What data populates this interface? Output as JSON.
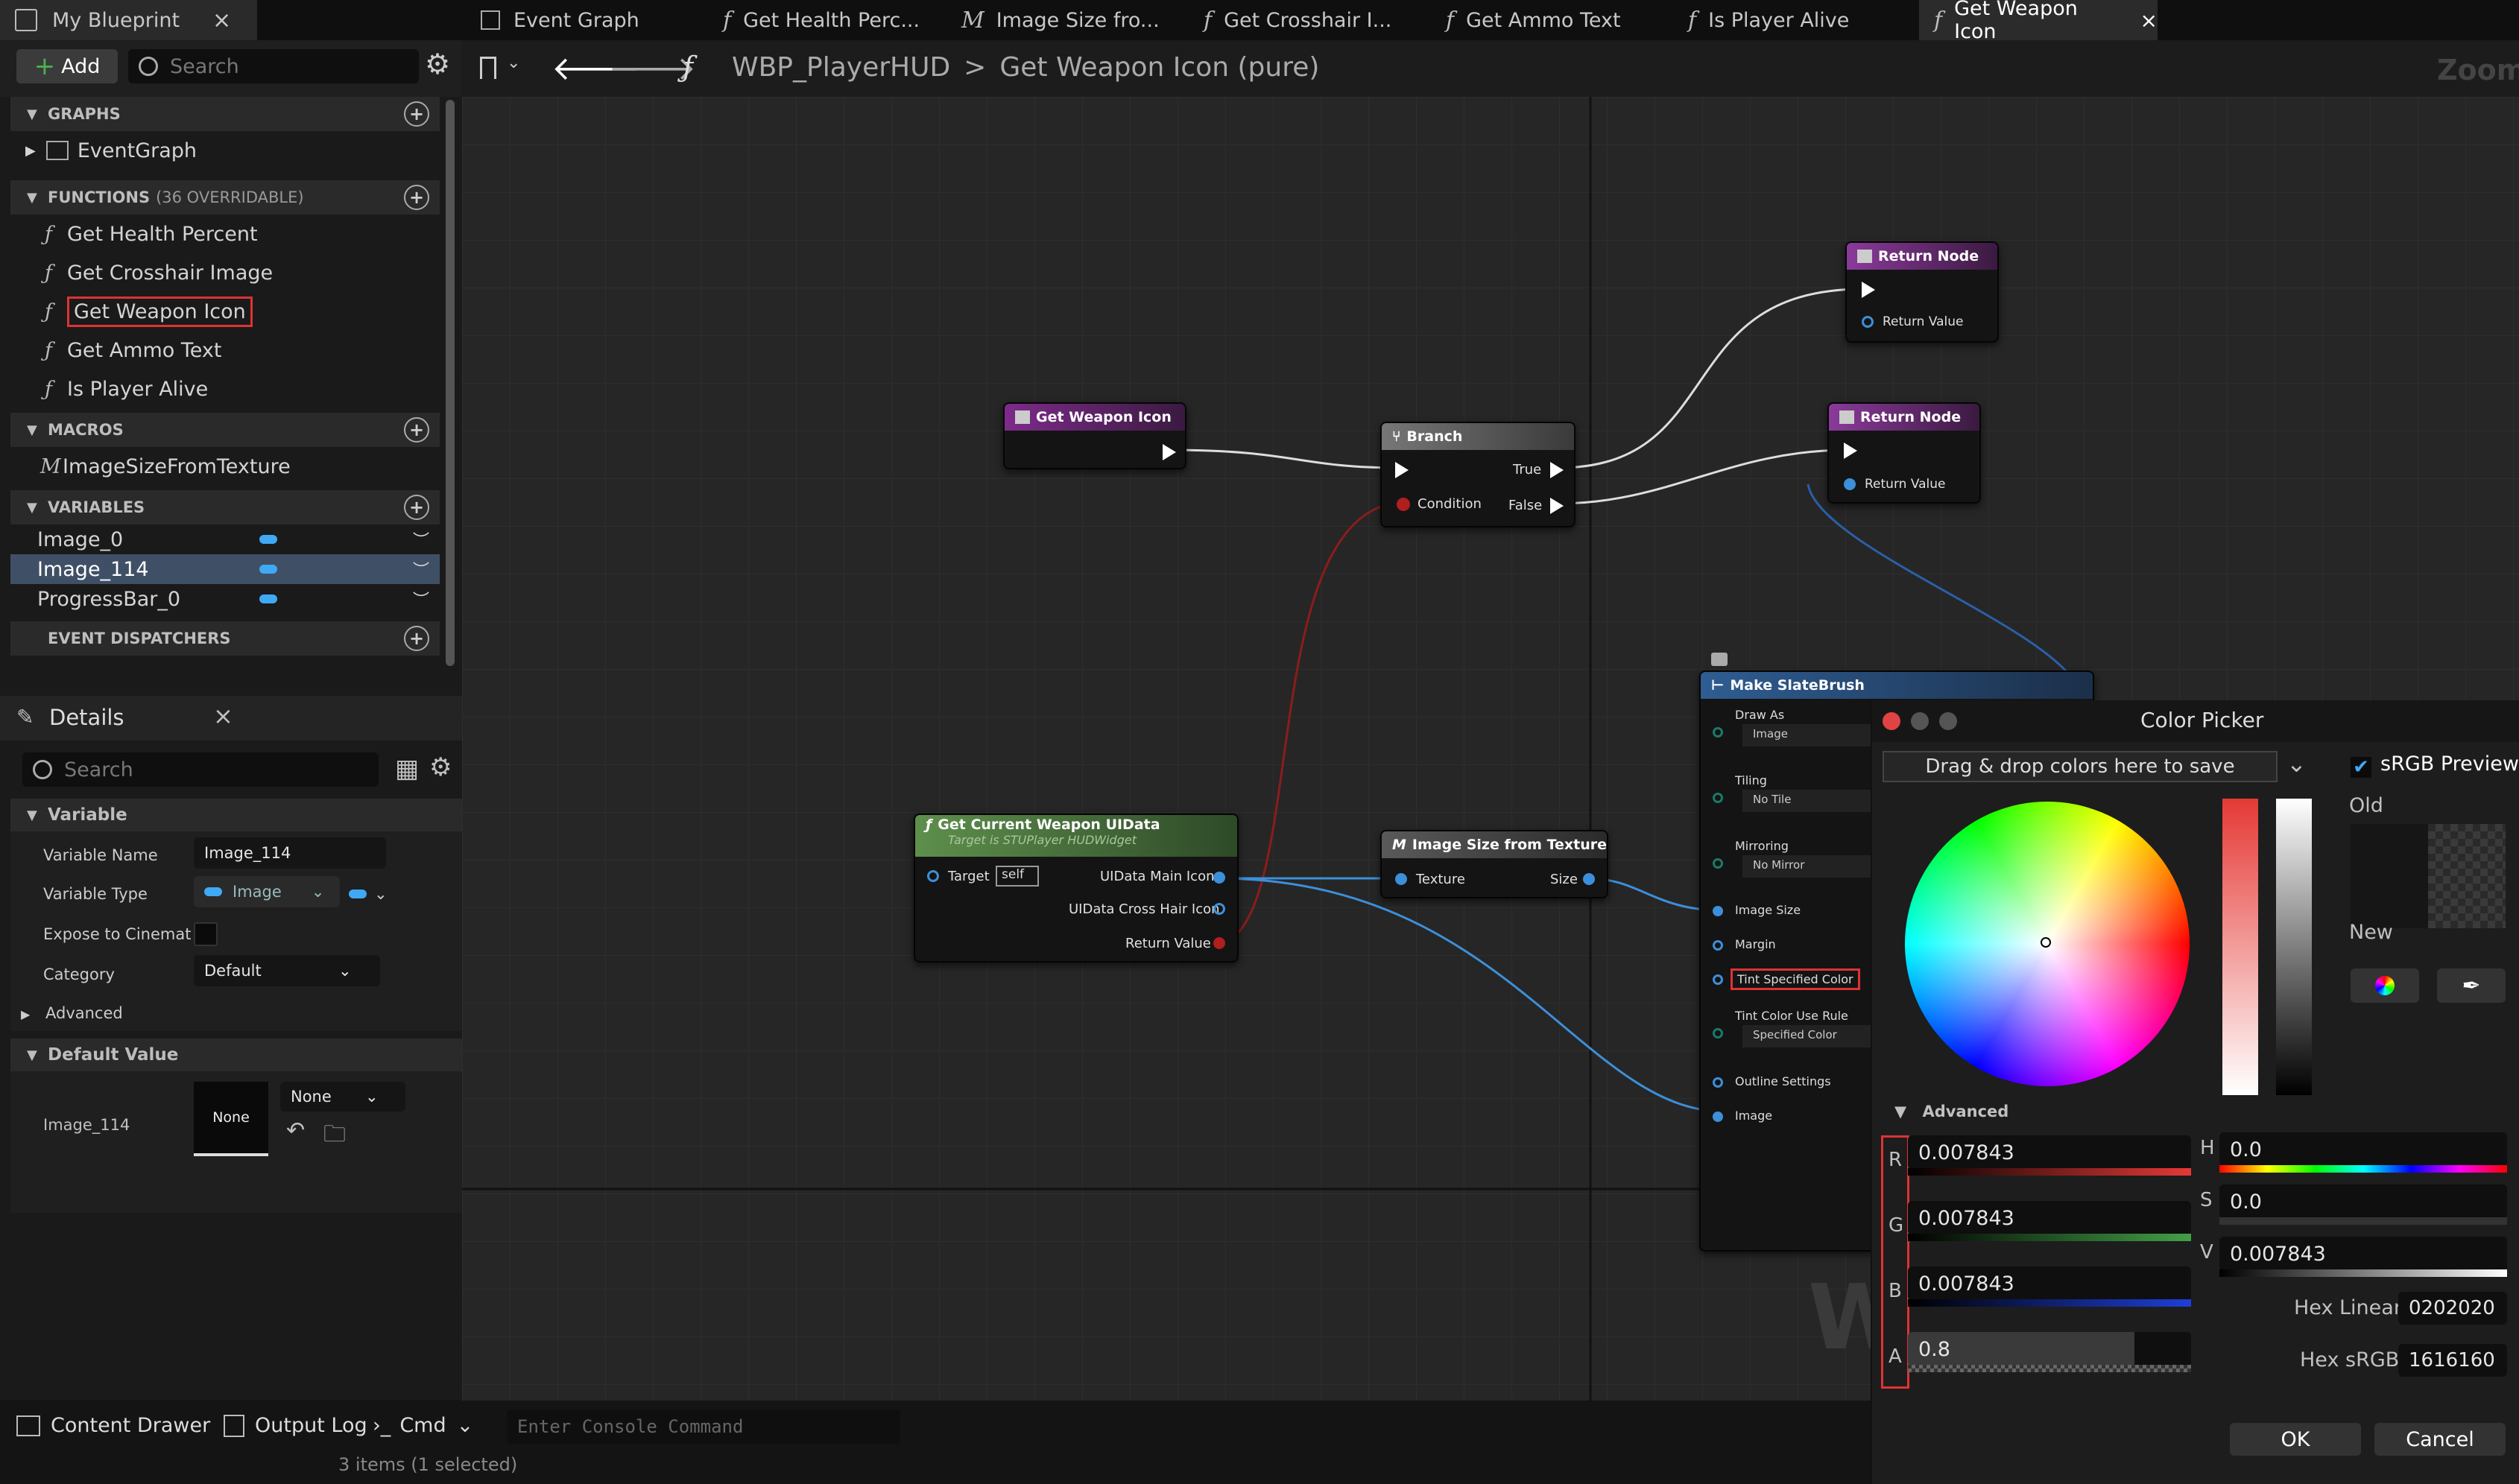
{
  "top_tabs": {
    "my_blueprint": "My Blueprint",
    "close": "×",
    "tabs": [
      {
        "prefix": "",
        "label": "Event Graph"
      },
      {
        "prefix": "f",
        "label": "Get Health Perc..."
      },
      {
        "prefix": "M",
        "label": "Image Size fro..."
      },
      {
        "prefix": "f",
        "label": "Get Crosshair I..."
      },
      {
        "prefix": "f",
        "label": "Get Ammo Text"
      },
      {
        "prefix": "f",
        "label": "Is Player Alive"
      },
      {
        "prefix": "f",
        "label": "Get Weapon Icon"
      }
    ]
  },
  "toolbar": {
    "add_label": "Add",
    "search_placeholder": "Search",
    "breadcrumb_root": "WBP_PlayerHUD",
    "breadcrumb_sep": ">",
    "breadcrumb_current": "Get Weapon Icon (pure)",
    "zoom": "Zoom"
  },
  "my_blueprint": {
    "graphs_head": "GRAPHS",
    "graphs": [
      "EventGraph"
    ],
    "functions_head": "FUNCTIONS",
    "functions_sub": "(36 OVERRIDABLE)",
    "functions": [
      "Get Health Percent",
      "Get Crosshair Image",
      "Get Weapon Icon",
      "Get Ammo Text",
      "Is Player Alive"
    ],
    "macros_head": "MACROS",
    "macros": [
      "ImageSizeFromTexture"
    ],
    "variables_head": "VARIABLES",
    "variables": [
      "Image_0",
      "Image_114",
      "ProgressBar_0"
    ],
    "dispatchers_head": "EVENT DISPATCHERS"
  },
  "details": {
    "title": "Details",
    "search_placeholder": "Search",
    "variable_head": "Variable",
    "rows": {
      "name_label": "Variable Name",
      "name_value": "Image_114",
      "type_label": "Variable Type",
      "type_value": "Image",
      "expose_label": "Expose to Cinemat",
      "category_label": "Category",
      "category_value": "Default",
      "advanced_label": "Advanced"
    },
    "default_head": "Default Value",
    "default_label": "Image_114",
    "default_thumb": "None",
    "default_select": "None"
  },
  "nodes": {
    "get_weapon_icon": "Get Weapon Icon",
    "branch": {
      "title": "Branch",
      "true": "True",
      "false": "False",
      "condition": "Condition"
    },
    "return1": {
      "title": "Return Node",
      "value": "Return Value"
    },
    "return2": {
      "title": "Return Node",
      "value": "Return Value"
    },
    "get_current": {
      "title": "Get Current Weapon UIData",
      "sub": "Target is STUPlayer HUDWidget",
      "target": "Target",
      "self": "self",
      "main_icon": "UIData Main Icon",
      "cross_icon": "UIData Cross Hair Icon",
      "ret": "Return Value"
    },
    "image_size": {
      "title": "Image Size from Texture",
      "texture": "Texture",
      "size": "Size"
    },
    "slatebrush": {
      "title": "Make SlateBrush",
      "draw_as": "Draw As",
      "draw_as_val": "Image",
      "tiling": "Tiling",
      "tiling_val": "No Tile",
      "mirroring": "Mirroring",
      "mirroring_val": "No Mirror",
      "image_size": "Image Size",
      "margin": "Margin",
      "tint": "Tint Specified Color",
      "tint_rule": "Tint Color Use Rule",
      "tint_rule_val": "Specified Color",
      "outline": "Outline Settings",
      "image": "Image"
    }
  },
  "picker": {
    "title": "Color Picker",
    "drop_label": "Drag & drop colors here to save",
    "srgb": "sRGB Preview",
    "old": "Old",
    "new": "New",
    "advanced": "Advanced",
    "r_label": "R",
    "r": "0.007843",
    "g_label": "G",
    "g": "0.007843",
    "b_label": "B",
    "b": "0.007843",
    "a_label": "A",
    "a": "0.8",
    "h_label": "H",
    "h": "0.0",
    "s_label": "S",
    "s": "0.0",
    "v_label": "V",
    "v": "0.007843",
    "hex_linear_label": "Hex Linear",
    "hex_linear": "0202020",
    "hex_srgb_label": "Hex sRGB",
    "hex_srgb": "1616160",
    "ok": "OK",
    "cancel": "Cancel",
    "watermark": "W"
  },
  "bottom": {
    "content_drawer": "Content Drawer",
    "output_log": "Output Log",
    "cmd": "Cmd",
    "console_placeholder": "Enter Console Command",
    "items": "3 items (1 selected)"
  }
}
